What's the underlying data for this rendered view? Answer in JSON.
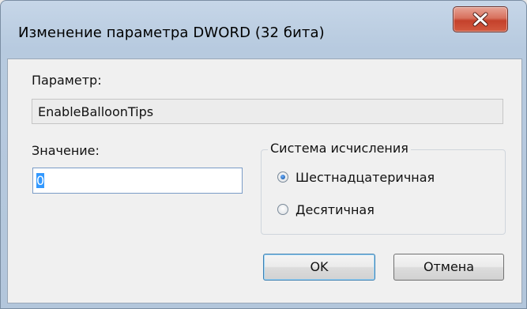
{
  "window": {
    "title": "Изменение параметра DWORD (32 бита)",
    "close_label": "X"
  },
  "form": {
    "param_label": "Параметр:",
    "param_value": "EnableBalloonTips",
    "value_label": "Значение:",
    "value_input": "0",
    "radix": {
      "legend": "Система исчисления",
      "options": [
        {
          "label": "Шестнадцатеричная",
          "checked": true
        },
        {
          "label": "Десятичная",
          "checked": false
        }
      ]
    }
  },
  "buttons": {
    "ok_label": "OK",
    "cancel_label": "Отмена"
  },
  "colors": {
    "titlebar": "#c6d6e8",
    "close_button": "#c4412b",
    "selection": "#3399ff"
  }
}
